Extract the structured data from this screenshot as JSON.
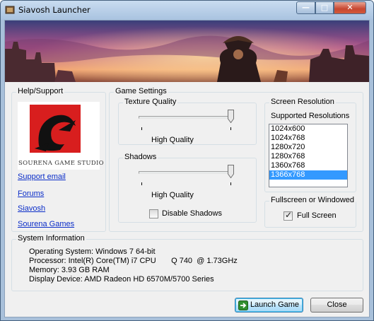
{
  "window": {
    "title": "Siavosh Launcher",
    "caption_min": "—",
    "caption_max": "□",
    "caption_close": "✕"
  },
  "help": {
    "legend": "Help/Support",
    "links": [
      "Support email",
      "Forums",
      "Siavosh",
      "Sourena Games"
    ],
    "logo_text": "SOURENA GAME STUDIO"
  },
  "game_settings": {
    "legend": "Game Settings",
    "texture": {
      "legend": "Texture Quality",
      "value_label": "High Quality",
      "level": 1.0
    },
    "shadows": {
      "legend": "Shadows",
      "value_label": "High Quality",
      "level": 1.0,
      "disable_label": "Disable Shadows",
      "disable_checked": false
    }
  },
  "resolution": {
    "legend": "Screen Resolution",
    "supported_label": "Supported Resolutions",
    "options": [
      "1024x600",
      "1024x768",
      "1280x720",
      "1280x768",
      "1360x768",
      "1366x768"
    ],
    "selected": "1366x768"
  },
  "fullscreen": {
    "legend": "Fullscreen or Windowed",
    "checkbox_label": "Full Screen",
    "checked": true
  },
  "system_info": {
    "legend": "System Information",
    "lines": [
      "Operating System: Windows 7  64-bit",
      "Processor: Intel(R) Core(TM) i7 CPU       Q 740  @ 1.73GHz",
      "Memory: 3.93 GB RAM",
      "Display Device: AMD Radeon HD 6570M/5700 Series"
    ]
  },
  "buttons": {
    "launch": "Launch Game",
    "close": "Close"
  },
  "colors": {
    "link": "#0a2dc8",
    "selection": "#3399ff",
    "logo_red": "#d81e1e"
  }
}
